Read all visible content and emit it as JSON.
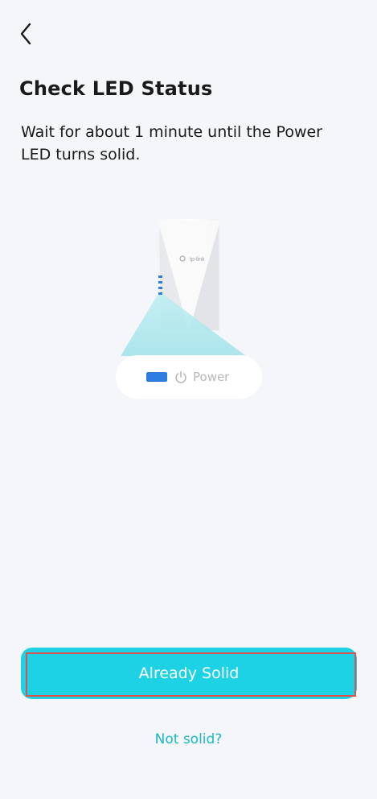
{
  "header": {
    "back_icon": "chevron-left-icon"
  },
  "page": {
    "title": "Check LED Status",
    "description": "Wait for about 1 minute until the Power LED turns solid."
  },
  "illustration": {
    "brand_label": "tp-link",
    "led_label": "Power",
    "led_color": "#2f7de1",
    "beam_color": "#a8e6ea"
  },
  "actions": {
    "primary_label": "Already Solid",
    "primary_color": "#1ed2e6",
    "secondary_label": "Not solid?",
    "secondary_color": "#19b8c6"
  }
}
